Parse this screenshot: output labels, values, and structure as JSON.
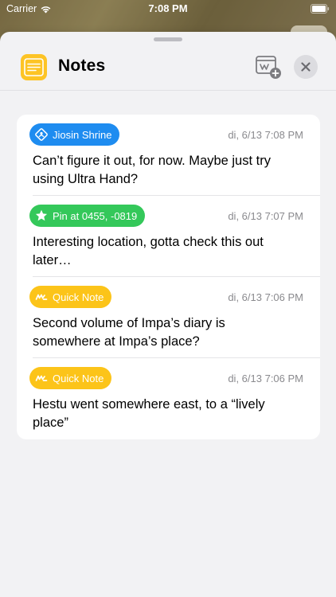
{
  "status_bar": {
    "carrier": "Carrier",
    "time": "7:08 PM"
  },
  "header": {
    "title": "Notes",
    "app_icon": "notes-icon",
    "add_widget_icon": "add-widget-icon",
    "close_icon": "close-icon"
  },
  "colors": {
    "shrine_blue": "#1e8cf0",
    "pin_green": "#34c85a",
    "quick_yellow": "#fcc419",
    "app_icon_yellow": "#fdc425"
  },
  "notes": [
    {
      "tag_label": "Jiosin Shrine",
      "tag_icon": "shrine-icon",
      "timestamp": "di, 6/13 7:08 PM",
      "text": "Can’t figure it out, for now. Maybe just try using Ultra Hand?"
    },
    {
      "tag_label": "Pin at 0455, -0819",
      "tag_icon": "star-icon",
      "timestamp": "di, 6/13 7:07 PM",
      "text": "Interesting location, gotta check this out later…"
    },
    {
      "tag_label": "Quick Note",
      "tag_icon": "quick-note-icon",
      "timestamp": "di, 6/13 7:06 PM",
      "text": "Second volume of Impa’s diary is somewhere at Impa’s place?"
    },
    {
      "tag_label": "Quick Note",
      "tag_icon": "quick-note-icon",
      "timestamp": "di, 6/13 7:06 PM",
      "text": "Hestu went somewhere east, to a “lively place”"
    }
  ]
}
